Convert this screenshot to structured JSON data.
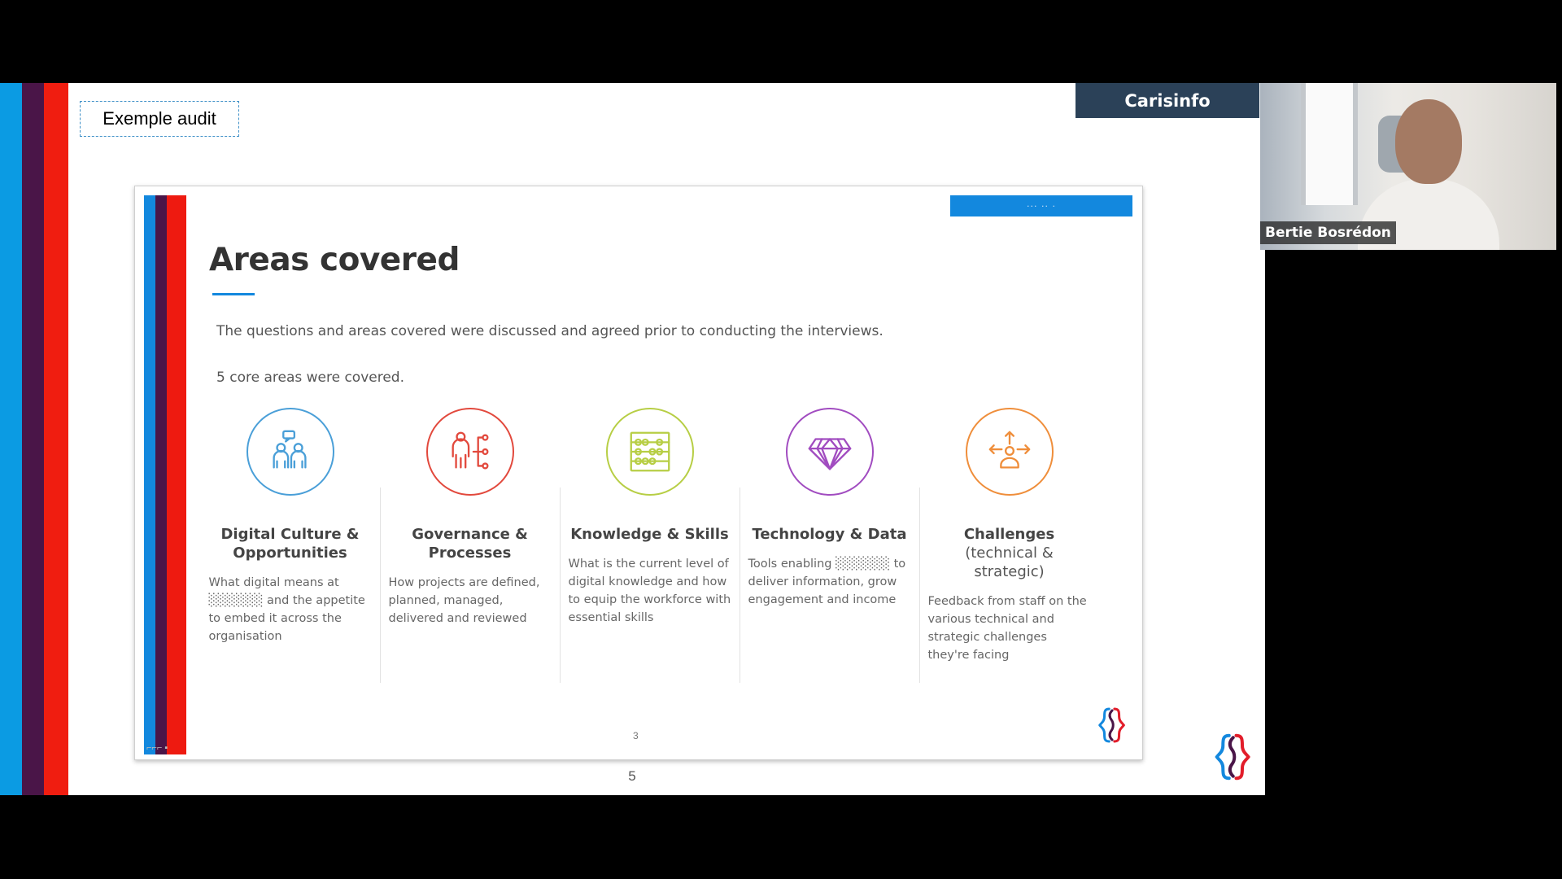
{
  "outer_slide": {
    "label_box": "Exemple audit",
    "brand_tag": "Carisinfo",
    "page_number": "5",
    "logo_icon": "brackets-logo-icon"
  },
  "inner_slide": {
    "tag": "··· ·· ·",
    "stripe_text": "⌐⌐⌐ ▪",
    "title": "Areas covered",
    "intro": "The questions and areas covered were discussed and agreed prior to conducting the interviews.",
    "core_areas": "5 core areas were covered.",
    "areas": [
      {
        "icon": "people-chat-icon",
        "color": "#4a9fd8",
        "title": "Digital Culture & Opportunities",
        "subtitle": "",
        "description": "What digital means at ░░░░░░ and the appetite to embed it across the organisation"
      },
      {
        "icon": "person-hierarchy-icon",
        "color": "#e2493d",
        "title": "Governance & Processes",
        "subtitle": "",
        "description": "How projects are defined, planned, managed, delivered and reviewed"
      },
      {
        "icon": "abacus-icon",
        "color": "#b7ce45",
        "title": "Knowledge & Skills",
        "subtitle": "",
        "description": "What is the current level of digital knowledge and how to equip the workforce with essential skills"
      },
      {
        "icon": "diamond-icon",
        "color": "#a14cc0",
        "title": "Technology & Data",
        "subtitle": "",
        "description": "Tools enabling ░░░░░░ to deliver information, grow engagement and income"
      },
      {
        "icon": "person-arrows-icon",
        "color": "#ef8e3b",
        "title": "Challenges",
        "subtitle": "(technical & strategic)",
        "description": "Feedback from staff on the various  technical and strategic challenges they're facing"
      }
    ],
    "page_number": "3",
    "logo_icon": "brackets-logo-icon"
  },
  "participant": {
    "name": "Bertie Bosrédon"
  }
}
